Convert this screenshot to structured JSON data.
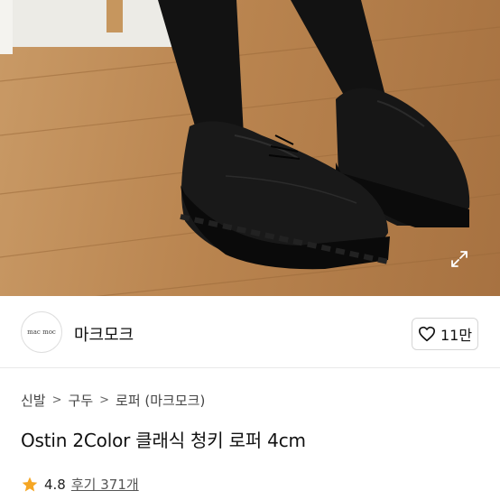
{
  "product": {
    "title": "Ostin 2Color 클래식 청키 로퍼 4cm",
    "image_alt": "black chunky loafers photo"
  },
  "shop": {
    "logo_text": "mac moc",
    "name": "마크모크",
    "likes": "11만"
  },
  "breadcrumb": [
    "신발",
    "구두",
    "로퍼 (마크모크)"
  ],
  "rating": {
    "score": "4.8",
    "reviews": "후기 371개"
  },
  "icons": {
    "expand": "expand-icon",
    "heart": "heart-icon",
    "star": "star-icon",
    "chevron": "chevron-right-icon"
  },
  "colors": {
    "star": "#f5a623",
    "floor": "#b9844f",
    "shoe": "#111111"
  }
}
